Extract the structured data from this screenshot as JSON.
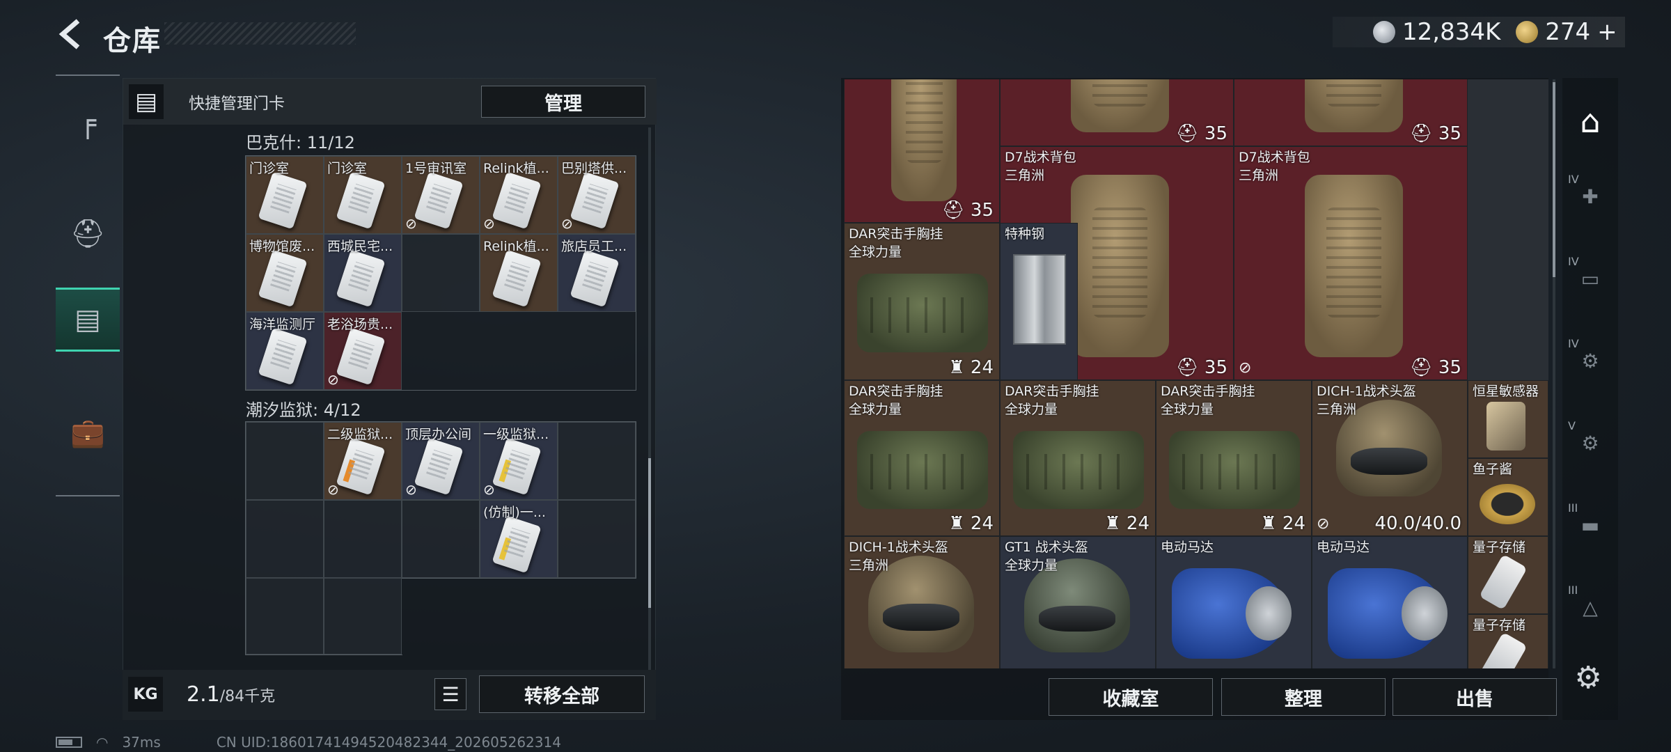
{
  "header": {
    "title": "仓库",
    "currency_silver": "12,834K",
    "currency_gold": "274",
    "gold_plus": "+"
  },
  "left_nav": {
    "items": [
      {
        "icon": "gun-icon"
      },
      {
        "icon": "backpack-icon"
      },
      {
        "icon": "keycard-holder-icon",
        "active": true
      },
      {
        "icon": "briefcase-icon"
      }
    ]
  },
  "keycard_panel": {
    "title": "快捷管理门卡",
    "manage_label": "管理",
    "sections": [
      {
        "title": "巴克什: 11/12",
        "cells": [
          {
            "label": "门诊室",
            "color": "brown",
            "lock": false
          },
          {
            "label": "门诊室",
            "color": "brown",
            "lock": false
          },
          {
            "label": "1号审讯室",
            "color": "brown",
            "lock": true
          },
          {
            "label": "Relink植...",
            "color": "brown",
            "lock": true
          },
          {
            "label": "巴别塔供...",
            "color": "brown",
            "lock": true
          },
          {
            "label": "博物馆废...",
            "color": "brown",
            "lock": false
          },
          {
            "label": "西城民宅...",
            "color": "blue",
            "lock": false
          },
          {
            "label": "",
            "color": "empty",
            "lock": false
          },
          {
            "label": "Relink植...",
            "color": "brown",
            "lock": false
          },
          {
            "label": "旅店员工...",
            "color": "blue",
            "lock": false
          },
          {
            "label": "海洋监测厅",
            "color": "blue",
            "lock": false
          },
          {
            "label": "老浴场贵...",
            "color": "red",
            "lock": true
          }
        ]
      },
      {
        "title": "潮汐监狱: 4/12",
        "cells": [
          {
            "label": "",
            "color": "empty"
          },
          {
            "label": "二级监狱...",
            "color": "brown",
            "lock": true,
            "card": "orange"
          },
          {
            "label": "顶层办公间",
            "color": "blue",
            "lock": true,
            "card": "white"
          },
          {
            "label": "一级监狱...",
            "color": "blue",
            "lock": true,
            "card": "yellow"
          },
          {
            "label": "",
            "color": "empty"
          },
          {
            "label": "",
            "color": "empty"
          },
          {
            "label": "",
            "color": "empty"
          },
          {
            "label": "",
            "color": "empty"
          },
          {
            "label": "(仿制)一...",
            "color": "blue",
            "lock": false,
            "card": "yellow"
          },
          {
            "label": "",
            "color": "empty"
          },
          {
            "label": "",
            "color": "empty"
          },
          {
            "label": "",
            "color": "empty"
          }
        ]
      }
    ],
    "weight_icon": "KG",
    "weight_value": "2.1",
    "weight_max": "/84千克",
    "transfer_all_label": "转移全部"
  },
  "stash": {
    "items": [
      {
        "id": "i1",
        "name": "",
        "sub": "",
        "count": "35",
        "color": "red",
        "art": "bag"
      },
      {
        "id": "i2",
        "name": "",
        "sub": "",
        "count": "35",
        "color": "red",
        "art": "bag"
      },
      {
        "id": "i3",
        "name": "",
        "sub": "",
        "count": "35",
        "color": "red",
        "art": "bag"
      },
      {
        "id": "i4",
        "name": "D7战术背包",
        "sub": "三角洲",
        "count": "35",
        "color": "red",
        "art": "bag",
        "lock": false
      },
      {
        "id": "i5",
        "name": "D7战术背包",
        "sub": "三角洲",
        "count": "35",
        "color": "red",
        "art": "bag",
        "lock": true
      },
      {
        "id": "i6",
        "name": "DAR突击手胸挂",
        "sub": "全球力量",
        "count": "24",
        "color": "brown",
        "art": "vest"
      },
      {
        "id": "i7",
        "name": "特种钢",
        "sub": "",
        "count": "",
        "color": "dark",
        "art": "steel"
      },
      {
        "id": "i8",
        "name": "DAR突击手胸挂",
        "sub": "全球力量",
        "count": "24",
        "color": "brown",
        "art": "vest"
      },
      {
        "id": "i9",
        "name": "DAR突击手胸挂",
        "sub": "全球力量",
        "count": "24",
        "color": "brown",
        "art": "vest"
      },
      {
        "id": "i10",
        "name": "DAR突击手胸挂",
        "sub": "全球力量",
        "count": "24",
        "color": "brown",
        "art": "vest"
      },
      {
        "id": "i11",
        "name": "DICH-1战术头盔",
        "sub": "三角洲",
        "count": "40.0/40.0",
        "color": "brown",
        "art": "helmet",
        "lock": true
      },
      {
        "id": "i12",
        "name": "恒星敏感器",
        "sub": "",
        "count": "",
        "color": "brown",
        "art": "sensor"
      },
      {
        "id": "i13",
        "name": "鱼子酱",
        "sub": "",
        "count": "",
        "color": "brown",
        "art": "caviar"
      },
      {
        "id": "i14",
        "name": "DICH-1战术头盔",
        "sub": "三角洲",
        "count": "",
        "color": "brown",
        "art": "helmet"
      },
      {
        "id": "i15",
        "name": "GT1 战术头盔",
        "sub": "全球力量",
        "count": "",
        "color": "dark",
        "art": "helmet2"
      },
      {
        "id": "i16",
        "name": "电动马达",
        "sub": "",
        "count": "",
        "color": "dark",
        "art": "motor"
      },
      {
        "id": "i17",
        "name": "电动马达",
        "sub": "",
        "count": "",
        "color": "dark",
        "art": "motor"
      },
      {
        "id": "i18",
        "name": "量子存储",
        "sub": "",
        "count": "",
        "color": "brown",
        "art": "chip"
      },
      {
        "id": "i19",
        "name": "量子存储",
        "sub": "",
        "count": "",
        "color": "brown",
        "art": "chip"
      }
    ],
    "buttons": {
      "collection": "收藏室",
      "sort": "整理",
      "sell": "出售"
    }
  },
  "right_nav": {
    "items": [
      {
        "icon": "stash-home-icon",
        "tier": ""
      },
      {
        "icon": "medkit-slot-icon",
        "tier": "IV"
      },
      {
        "icon": "folder-slot-icon",
        "tier": "IV"
      },
      {
        "icon": "gear-slot-icon",
        "tier": "IV"
      },
      {
        "icon": "gear-slot-icon",
        "tier": "V"
      },
      {
        "icon": "gun-slot-icon",
        "tier": "III"
      },
      {
        "icon": "triangle-slot-icon",
        "tier": "III"
      }
    ]
  },
  "status_bar": {
    "ping": "37ms",
    "uid": "CN UID:18601741494520482344_202605262314"
  }
}
